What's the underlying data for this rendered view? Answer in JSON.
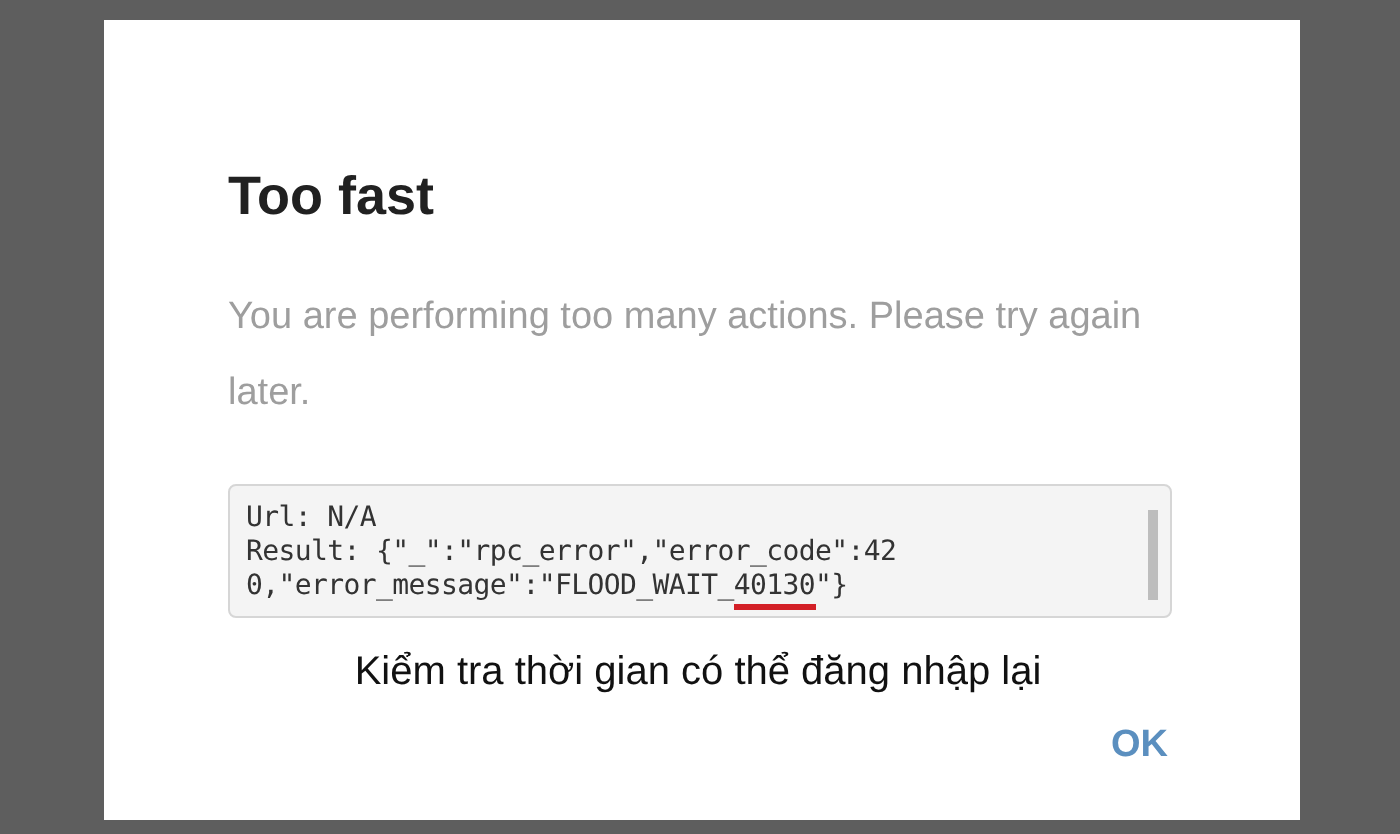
{
  "dialog": {
    "title": "Too fast",
    "message": "You are performing too many actions. Please try again later.",
    "log_lines": [
      {
        "text": "Url: N/A"
      },
      {
        "text": "Result: {\"_\":\"rpc_error\",\"error_code\":42"
      },
      {
        "text": "0,\"error_message\":\"FLOOD_WAIT_",
        "highlight": "40130",
        "after": "\"}"
      }
    ],
    "annotation": "Kiểm tra thời gian có thể đăng nhập lại",
    "buttons": [
      "OK"
    ]
  }
}
